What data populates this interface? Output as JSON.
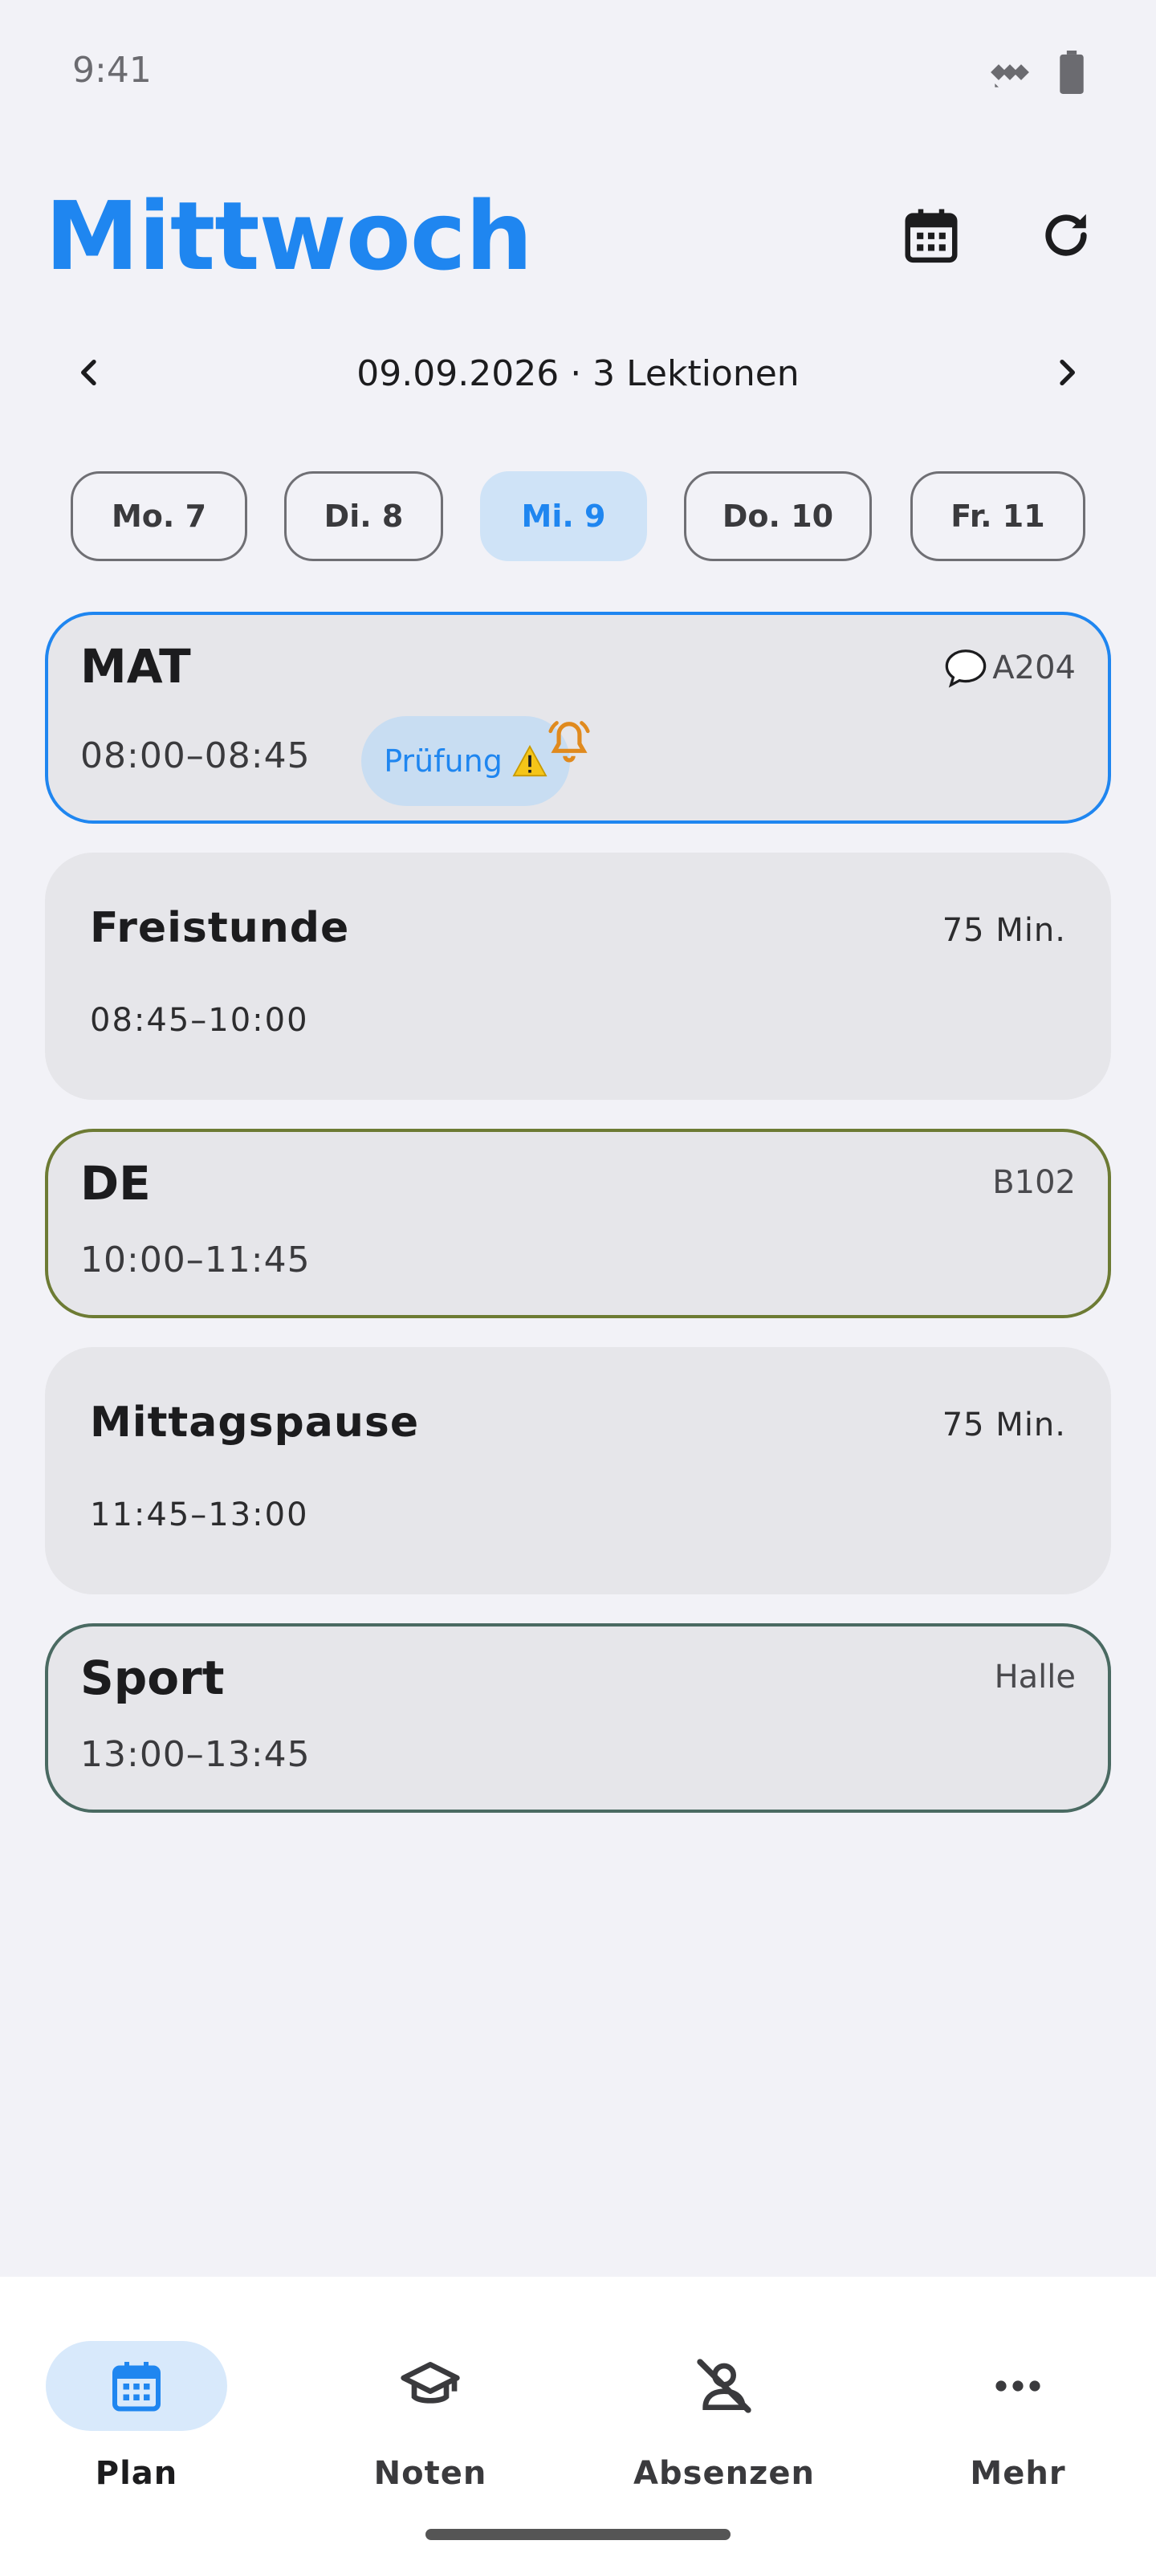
{
  "status_bar": {
    "time": "9:41"
  },
  "header": {
    "title": "Mittwoch"
  },
  "date_nav": {
    "label": "09.09.2026 · 3 Lektionen"
  },
  "days": [
    {
      "label": "Mo. 7",
      "active": false
    },
    {
      "label": "Di. 8",
      "active": false
    },
    {
      "label": "Mi. 9",
      "active": true
    },
    {
      "label": "Do. 10",
      "active": false
    },
    {
      "label": "Fr. 11",
      "active": false
    }
  ],
  "schedule": {
    "mat": {
      "subject": "MAT",
      "time": "08:00–08:45",
      "room": "A204",
      "badge": "Prüfung",
      "border_color": "#1f86f0"
    },
    "free": {
      "title": "Freistunde",
      "time": "08:45–10:00",
      "duration": "75 Min."
    },
    "de": {
      "subject": "DE",
      "time": "10:00–11:45",
      "room": "B102",
      "border_color": "#6d7b34"
    },
    "lunch": {
      "title": "Mittagspause",
      "time": "11:45–13:00",
      "duration": "75 Min."
    },
    "sport": {
      "subject": "Sport",
      "time": "13:00–13:45",
      "room": "Halle",
      "border_color": "#4a6a62"
    }
  },
  "bottom_nav": {
    "plan": "Plan",
    "grades": "Noten",
    "absences": "Absenzen",
    "more": "Mehr"
  },
  "colors": {
    "accent": "#1f86f0",
    "warning": "#e08a1e"
  }
}
